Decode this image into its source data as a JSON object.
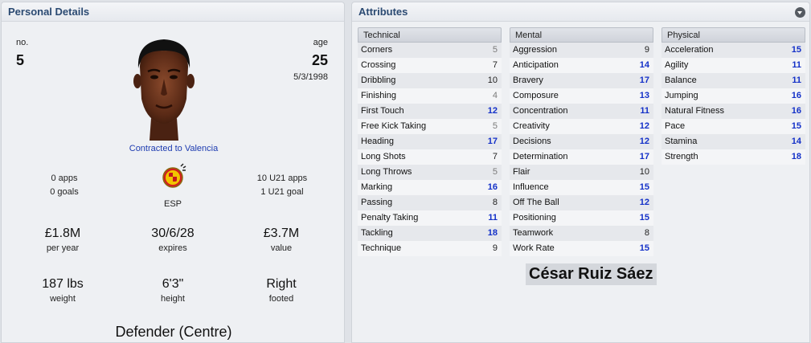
{
  "personal": {
    "header": "Personal Details",
    "no_label": "no.",
    "no_value": "5",
    "age_label": "age",
    "age_value": "25",
    "dob": "5/3/1998",
    "contract": "Contracted to Valencia",
    "apps": "0 apps",
    "goals": "0 goals",
    "nation": "ESP",
    "u21_apps": "10 U21 apps",
    "u21_goals": "1 U21 goal",
    "wage": "£1.8M",
    "wage_label": "per year",
    "expires": "30/6/28",
    "expires_label": "expires",
    "value": "£3.7M",
    "value_label": "value",
    "weight": "187 lbs",
    "weight_label": "weight",
    "height": "6'3\"",
    "height_label": "height",
    "foot": "Right",
    "foot_label": "footed",
    "position": "Defender (Centre)"
  },
  "attributes": {
    "header": "Attributes",
    "collapse_icon": "chevron-down-circle-icon",
    "player_name": "César Ruiz Sáez",
    "colors": {
      "high": "#1431c8",
      "low": "#7a7a7a",
      "normal": "#222222"
    },
    "technical": {
      "title": "Technical",
      "rows": [
        {
          "name": "Corners",
          "value": "5"
        },
        {
          "name": "Crossing",
          "value": "7"
        },
        {
          "name": "Dribbling",
          "value": "10"
        },
        {
          "name": "Finishing",
          "value": "4"
        },
        {
          "name": "First Touch",
          "value": "12"
        },
        {
          "name": "Free Kick Taking",
          "value": "5"
        },
        {
          "name": "Heading",
          "value": "17"
        },
        {
          "name": "Long Shots",
          "value": "7"
        },
        {
          "name": "Long Throws",
          "value": "5"
        },
        {
          "name": "Marking",
          "value": "16"
        },
        {
          "name": "Passing",
          "value": "8"
        },
        {
          "name": "Penalty Taking",
          "value": "11"
        },
        {
          "name": "Tackling",
          "value": "18"
        },
        {
          "name": "Technique",
          "value": "9"
        }
      ]
    },
    "mental": {
      "title": "Mental",
      "rows": [
        {
          "name": "Aggression",
          "value": "9"
        },
        {
          "name": "Anticipation",
          "value": "14"
        },
        {
          "name": "Bravery",
          "value": "17"
        },
        {
          "name": "Composure",
          "value": "13"
        },
        {
          "name": "Concentration",
          "value": "11"
        },
        {
          "name": "Creativity",
          "value": "12"
        },
        {
          "name": "Decisions",
          "value": "12"
        },
        {
          "name": "Determination",
          "value": "17"
        },
        {
          "name": "Flair",
          "value": "10"
        },
        {
          "name": "Influence",
          "value": "15"
        },
        {
          "name": "Off The Ball",
          "value": "12"
        },
        {
          "name": "Positioning",
          "value": "15"
        },
        {
          "name": "Teamwork",
          "value": "8"
        },
        {
          "name": "Work Rate",
          "value": "15"
        }
      ]
    },
    "physical": {
      "title": "Physical",
      "rows": [
        {
          "name": "Acceleration",
          "value": "15"
        },
        {
          "name": "Agility",
          "value": "11"
        },
        {
          "name": "Balance",
          "value": "11"
        },
        {
          "name": "Jumping",
          "value": "16"
        },
        {
          "name": "Natural Fitness",
          "value": "16"
        },
        {
          "name": "Pace",
          "value": "15"
        },
        {
          "name": "Stamina",
          "value": "14"
        },
        {
          "name": "Strength",
          "value": "18"
        }
      ]
    }
  }
}
